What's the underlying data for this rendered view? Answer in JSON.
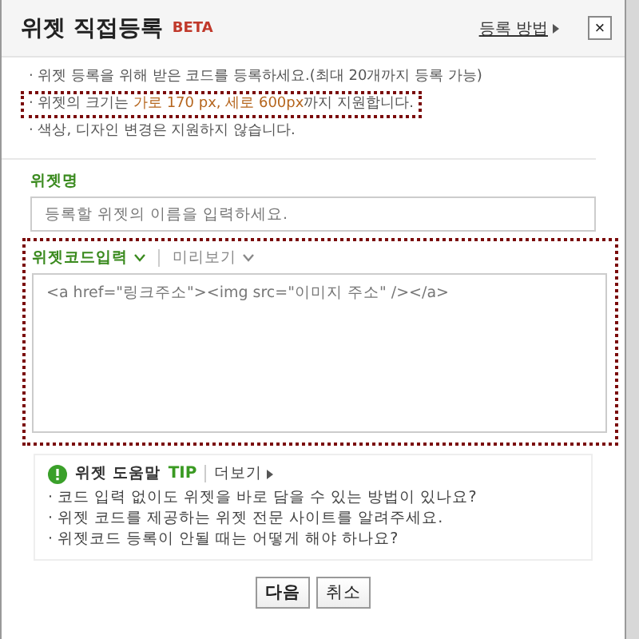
{
  "dialog": {
    "title": "위젯 직접등록",
    "badge": "BETA",
    "help_link": "등록 방법",
    "close": "×"
  },
  "notes": [
    {
      "text": "· 위젯 등록을 위해 받은 코드를 등록하세요.(최대 20개까지 등록 가능)",
      "highlighted": false
    },
    {
      "text": "· 위젯의 크기는 **가로 170 px, 세로 600px**까지 지원합니다.",
      "highlighted": true
    },
    {
      "text": "· 색상, 디자인 변경은 지원하지 않습니다.",
      "highlighted": false
    }
  ],
  "name_field": {
    "label": "위젯명",
    "placeholder": "등록할 위젯의 이름을 입력하세요."
  },
  "code_section": {
    "highlighted": true,
    "tabs": [
      {
        "label": "위젯코드입력",
        "selected": true
      },
      {
        "label": "미리보기",
        "selected": false
      }
    ],
    "placeholder": "<a href=\"링크주소\"><img src=\"이미지 주소\" /></a>"
  },
  "tips": {
    "title": "위젯 도움말",
    "badge": "TIP",
    "more": "더보기",
    "items": [
      "· 코드 입력 없이도 위젯을 바로 담을 수 있는 방법이 있나요?",
      "· 위젯 코드를 제공하는 위젯 전문 사이트를 알려주세요.",
      "· 위젯코드 등록이 안될 때는 어떻게 해야 하나요?"
    ]
  },
  "buttons": [
    {
      "label": "다음",
      "primary": true
    },
    {
      "label": "취소",
      "primary": false
    }
  ]
}
